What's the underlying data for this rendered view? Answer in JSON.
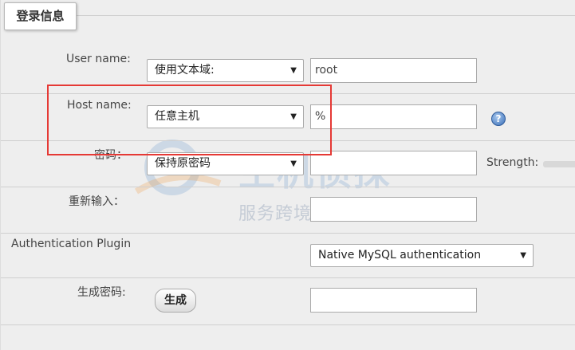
{
  "legend": "登录信息",
  "rows": {
    "username": {
      "label": "User name:",
      "select": "使用文本域:",
      "value": "root"
    },
    "hostname": {
      "label": "Host name:",
      "select": "任意主机",
      "value": "%"
    },
    "password": {
      "label": "密码：",
      "select": "保持原密码",
      "value": "",
      "strength_label": "Strength:"
    },
    "retype": {
      "label": "重新输入：",
      "value": ""
    },
    "auth_plugin": {
      "label": "Authentication Plugin",
      "select": "Native MySQL authentication"
    },
    "generate": {
      "label": "生成密码:",
      "button": "生成",
      "value": ""
    }
  },
  "help_icon": "question-icon",
  "watermark": {
    "main": "主机侦探",
    "sub": "服务跨境电商 助力中企出海"
  },
  "colors": {
    "highlight": "#e53935",
    "background": "#eeeeee"
  }
}
